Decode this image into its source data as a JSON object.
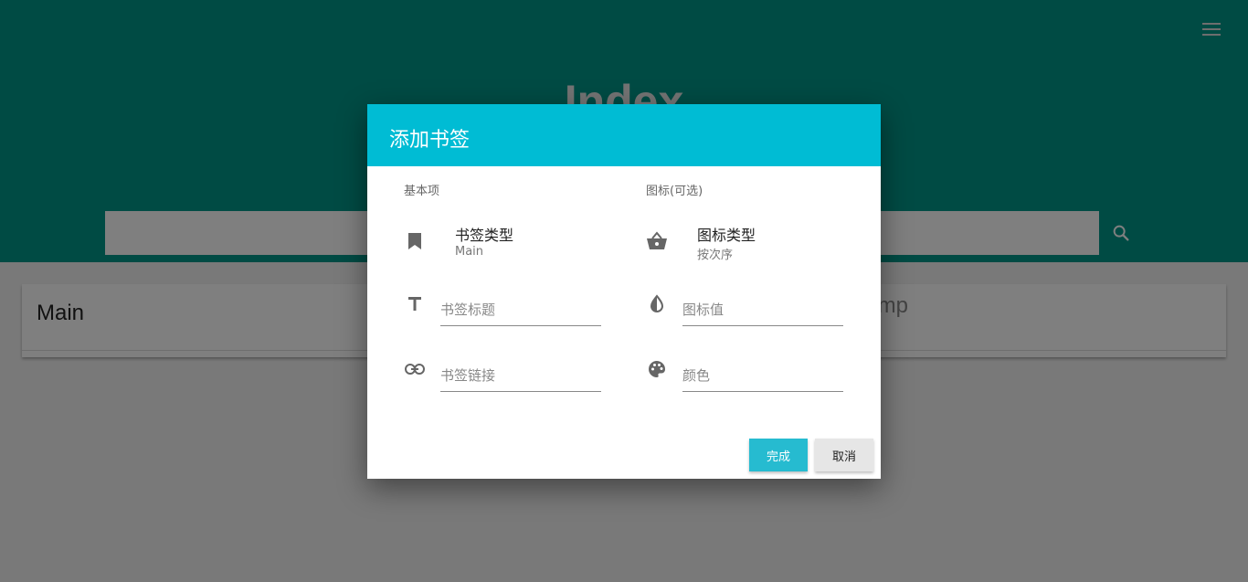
{
  "page": {
    "title": "Index",
    "menu_icon": "hamburger-menu-icon",
    "search_icon": "search-icon",
    "search_placeholder": ""
  },
  "cards": [
    {
      "title": "Main"
    },
    {
      "title": "mp"
    }
  ],
  "dialog": {
    "title": "添加书签",
    "basic_section": "基本项",
    "icon_section": "图标(可选)",
    "bookmark_type": {
      "label": "书签类型",
      "value": "Main",
      "icon": "bookmark-icon"
    },
    "icon_type": {
      "label": "图标类型",
      "value": "按次序",
      "icon": "basket-icon"
    },
    "fields": {
      "bookmark_title": {
        "placeholder": "书签标题",
        "value": "",
        "icon": "text-format-icon"
      },
      "icon_value": {
        "placeholder": "图标值",
        "value": "",
        "icon": "contrast-drop-icon"
      },
      "bookmark_link": {
        "placeholder": "书签链接",
        "value": "",
        "icon": "link-icon"
      },
      "color": {
        "placeholder": "颜色",
        "value": "",
        "icon": "palette-icon"
      }
    },
    "buttons": {
      "done": "完成",
      "cancel": "取消"
    }
  },
  "colors": {
    "header": "#009688",
    "dialog_header": "#00bcd4",
    "done_button": "#26bbd0",
    "cancel_button": "#e6e6e6"
  }
}
